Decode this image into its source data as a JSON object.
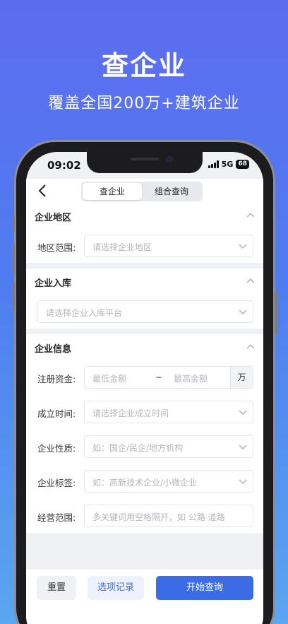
{
  "promo": {
    "title": "查企业",
    "subtitle": "覆盖全国200万+建筑企业"
  },
  "status": {
    "time": "09:02",
    "network": "5G",
    "battery": "68"
  },
  "nav": {
    "tabs": [
      {
        "label": "查企业",
        "active": true
      },
      {
        "label": "组合查询",
        "active": false
      }
    ]
  },
  "sections": {
    "region": {
      "title": "企业地区",
      "label": "地区范围:",
      "placeholder": "请选择企业地区"
    },
    "storage": {
      "title": "企业入库",
      "placeholder": "请选择企业入库平台"
    },
    "info": {
      "title": "企业信息",
      "capital": {
        "label": "注册资金:",
        "min_placeholder": "最低金额",
        "sep": "~",
        "max_placeholder": "最高金额",
        "unit": "万"
      },
      "founded": {
        "label": "成立时间:",
        "placeholder": "请选择企业成立时间"
      },
      "nature": {
        "label": "企业性质:",
        "placeholder": "如：国企/民企/地方机构"
      },
      "tags": {
        "label": "企业标签:",
        "placeholder": "如：高新技术企业/小微企业"
      },
      "scope": {
        "label": "经营范围:",
        "placeholder": "多关键词用空格隔开，如 公路 道路"
      }
    }
  },
  "actions": {
    "reset": "重置",
    "history": "选项记录",
    "search": "开始查询"
  },
  "colors": {
    "accent": "#3b6ce6",
    "bg_top": "#5d6cf0",
    "bg_bottom": "#5aa6f0"
  }
}
